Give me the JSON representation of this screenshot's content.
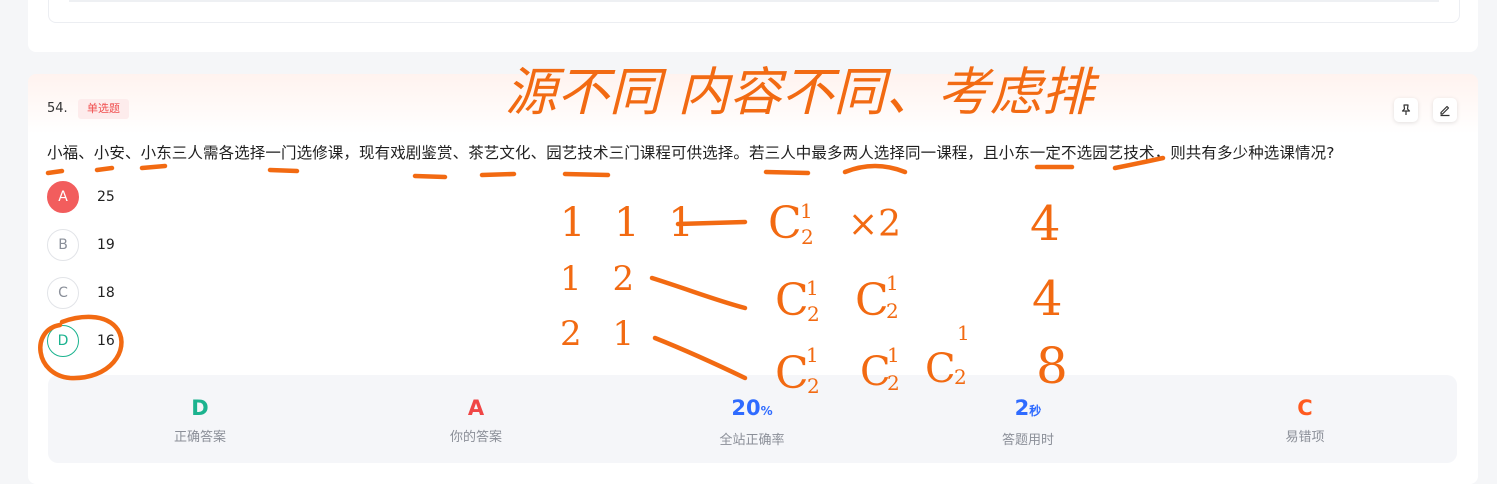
{
  "question": {
    "number": "54.",
    "type_tag": "单选题",
    "stem": "小福、小安、小东三人需各选择一门选修课，现有戏剧鉴赏、茶艺文化、园艺技术三门课程可供选择。若三人中最多两人选择同一课程，且小东一定不选园艺技术，则共有多少种选课情况?",
    "options": [
      {
        "letter": "A",
        "value": "25"
      },
      {
        "letter": "B",
        "value": "19"
      },
      {
        "letter": "C",
        "value": "18"
      },
      {
        "letter": "D",
        "value": "16"
      }
    ],
    "tools": {
      "pin_icon": "pin-icon",
      "edit_icon": "edit-icon"
    }
  },
  "stats": {
    "correct_answer": {
      "value": "D",
      "label": "正确答案",
      "color": "#1bb38f"
    },
    "your_answer": {
      "value": "A",
      "label": "你的答案",
      "color": "#f04646"
    },
    "site_accuracy": {
      "value": "20",
      "unit": "%",
      "label": "全站正确率",
      "color": "#2f6bff"
    },
    "time_used": {
      "value": "2",
      "unit": "秒",
      "label": "答题用时",
      "color": "#2f6bff"
    },
    "common_wrong": {
      "value": "C",
      "label": "易错项",
      "color": "#ff5a1f"
    }
  },
  "handwriting": {
    "title": "源不同 内容不同、考虑排",
    "row1": {
      "partition": "1 1 1",
      "formula": "C",
      "sup": "1",
      "sub": "2",
      "tail": "×2",
      "result": "4"
    },
    "row2": {
      "partition": "1 2",
      "formula1": "C",
      "sup1": "1",
      "sub1": "2",
      "formula2": "C",
      "sup2": "1",
      "sub2": "2",
      "result": "4"
    },
    "row3": {
      "partition": "2 1",
      "formula1": "C",
      "sup1": "1",
      "sub1": "2",
      "formula2": "C",
      "sup2": "1",
      "sub2": "2",
      "formula3": "C",
      "sup3": "1",
      "sub3": "2",
      "result": "8"
    },
    "ink_color": "#f26a12"
  }
}
